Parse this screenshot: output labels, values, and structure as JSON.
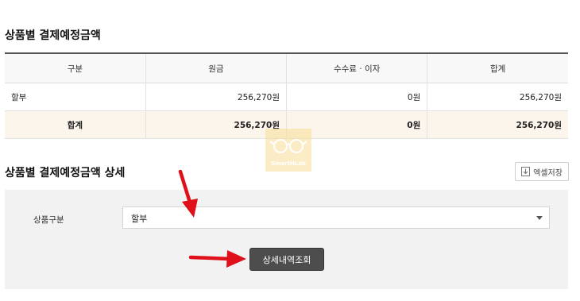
{
  "section1": {
    "title": "상품별 결제예정금액"
  },
  "summary_table": {
    "headers": [
      "구분",
      "원금",
      "수수료 · 이자",
      "합계"
    ],
    "rows": [
      {
        "type": "할부",
        "principal": "256,270원",
        "fee": "0원",
        "total": "256,270원"
      }
    ],
    "total_row": {
      "type": "합계",
      "principal": "256,270원",
      "fee": "0원",
      "total": "256,270원"
    }
  },
  "section2": {
    "title": "상품별 결제예정금액 상세",
    "excel_label": "엑셀저장"
  },
  "filter": {
    "label": "상품구분",
    "selected": "할부",
    "search_label": "상세내역조회"
  },
  "watermark": {
    "text": "SmartHLab"
  },
  "colors": {
    "arrow": "#e0101b",
    "total_row_bg": "#fbf5ec",
    "button_bg": "#4d4d4d",
    "panel_bg": "#f2f2f2"
  },
  "icons": {
    "excel": "download-icon",
    "select": "chevron-down-icon"
  }
}
